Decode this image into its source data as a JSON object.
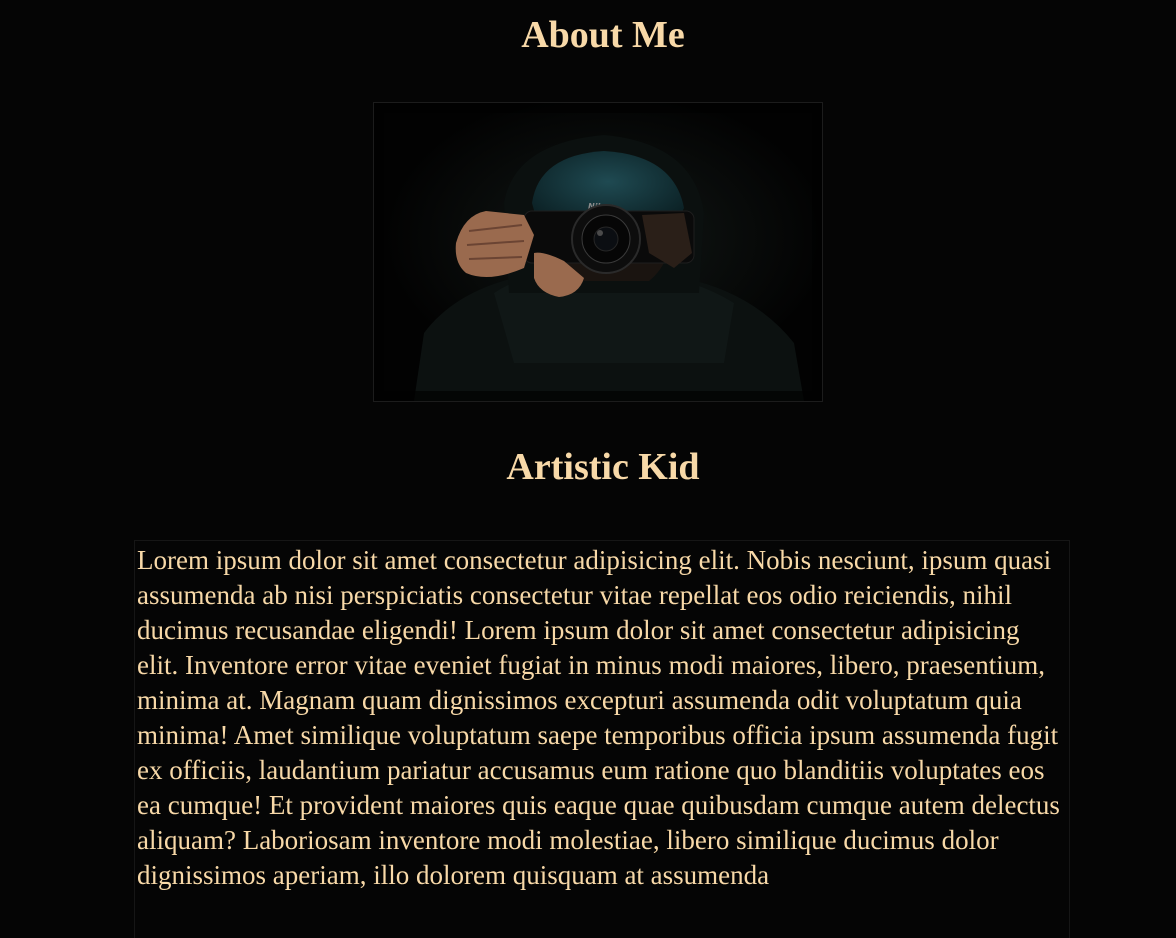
{
  "header": {
    "title": "About Me"
  },
  "photo": {
    "icon": "photographer-with-camera-image",
    "camera_brand": "Nikon"
  },
  "profile": {
    "name": "Artistic Kid",
    "bio": "Lorem ipsum dolor sit amet consectetur adipisicing elit. Nobis nesciunt, ipsum quasi assumenda ab nisi perspiciatis consectetur vitae repellat eos odio reiciendis, nihil ducimus recusandae eligendi! Lorem ipsum dolor sit amet consectetur adipisicing elit. Inventore error vitae eveniet fugiat in minus modi maiores, libero, praesentium, minima at. Magnam quam dignissimos excepturi assumenda odit voluptatum quia minima! Amet similique voluptatum saepe temporibus officia ipsum assumenda fugit ex officiis, laudantium pariatur accusamus eum ratione quo blanditiis voluptates eos ea cumque! Et provident maiores quis eaque quae quibusdam cumque autem delectus aliquam? Laboriosam inventore modi molestiae, libero similique ducimus dolor dignissimos aperiam, illo dolorem quisquam at assumenda"
  },
  "colors": {
    "background": "#050505",
    "text": "#f8d9a8"
  }
}
